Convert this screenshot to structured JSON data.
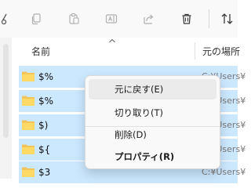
{
  "header": {
    "name_col": "名前",
    "path_col": "元の場所"
  },
  "rows": [
    {
      "name": "$%",
      "path": "C:¥Users¥"
    },
    {
      "name": "$%",
      "path": "C:¥Users¥"
    },
    {
      "name": "$)",
      "path": "C:¥Users¥"
    },
    {
      "name": "${",
      "path": "C:¥Users¥"
    },
    {
      "name": "$3",
      "path": "C:¥Users¥"
    }
  ],
  "context_menu": {
    "items": [
      "元に戻す(E)",
      "切り取り(T)",
      "削除(D)",
      "プロパティ(R)"
    ]
  },
  "colors": {
    "selection": "#cce8ff",
    "menu_bg": "#f9f9f9",
    "menu_hover": "#ebebeb",
    "toolbar_icon": "#b0b0b0"
  }
}
